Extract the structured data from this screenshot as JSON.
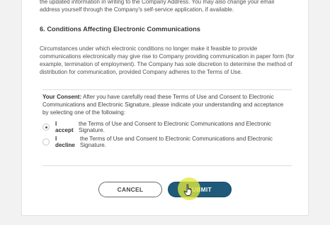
{
  "document": {
    "top_text": "the updated information in writing to the Company Address. You may also change your email address yourself through the Company's self-service application, if available.",
    "section_heading": "6. Conditions Affecting Electronic Communications",
    "section_paragraph": "Circumstances under which electronic conditions no longer make it feasible to provide communications electronically may give rise to Company providing communication in paper form (for example, termination of employment). The Company has sole discretion to determine the method of distribution for communication, provided Company adheres to the Terms of Use."
  },
  "consent": {
    "label": "Your Consent:",
    "intro": "After you have carefully read these Terms of Use and Consent to Electronic Communications and Electronic Signature, please indicate your understanding and acceptance by selecting one of the following:",
    "options": [
      {
        "bold": "I accept",
        "text": "the Terms of Use and Consent to Electronic Communications and Electronic Signature.",
        "checked": true
      },
      {
        "bold": "I decline",
        "text": "the Terms of Use and Consent to Electronic Communications and Electronic Signature.",
        "checked": false
      }
    ]
  },
  "buttons": {
    "cancel_label": "CANCEL",
    "submit_label": "SUBMIT"
  },
  "colors": {
    "submit_bg": "#1f5a7a",
    "highlight": "#e2e83c"
  },
  "icons": {
    "cursor": "hand-pointer-icon"
  }
}
